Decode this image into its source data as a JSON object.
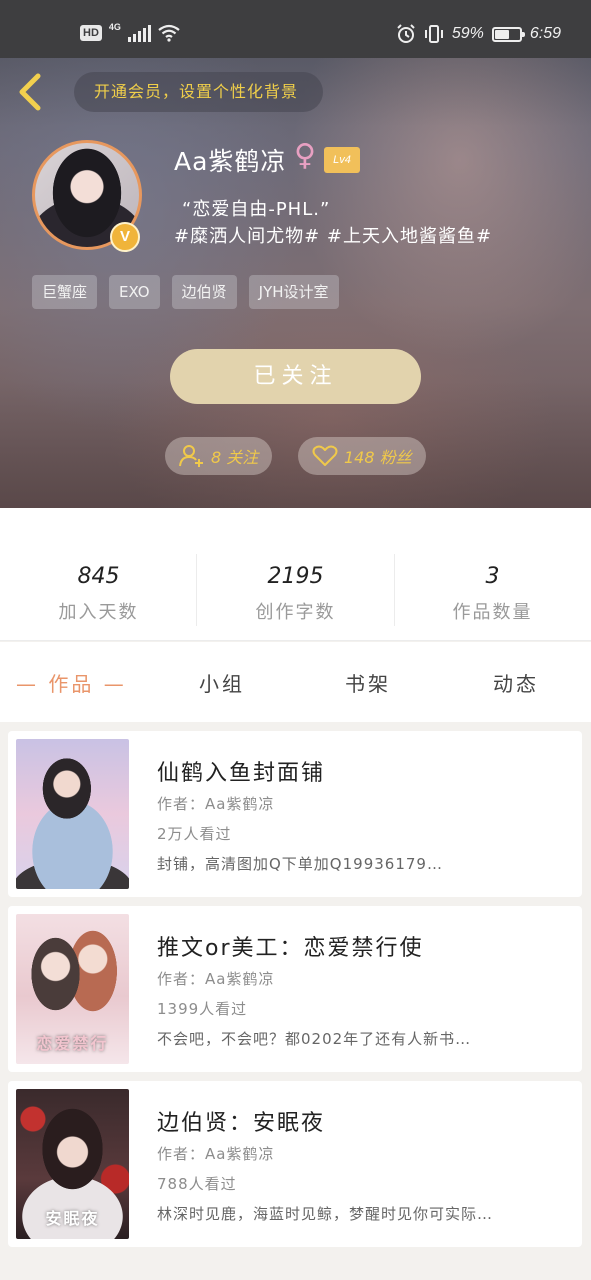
{
  "status_bar": {
    "hd": "HD",
    "network": "4G",
    "battery_percent": "59%",
    "battery_level": 0.59,
    "time": "6:59"
  },
  "header": {
    "vip_prompt": "开通会员，设置个性化背景"
  },
  "profile": {
    "username": "Aa紫鹤凉",
    "gender_symbol": "♀",
    "level": "Lv4",
    "avatar_badge": "V",
    "signature_line1": "“恋爱自由-PHL.”",
    "signature_line2": "#糜洒人间尤物# #上天入地酱酱鱼#",
    "tags": [
      "巨蟹座",
      "EXO",
      "边伯贤",
      "JYH设计室"
    ],
    "follow_label": "已关注",
    "following_text": "8 关注",
    "fans_text": "148 粉丝"
  },
  "stats": [
    {
      "value": "845",
      "label": "加入天数"
    },
    {
      "value": "2195",
      "label": "创作字数"
    },
    {
      "value": "3",
      "label": "作品数量"
    }
  ],
  "tabs": [
    {
      "label": "— 作品 —",
      "active": true
    },
    {
      "label": "小组",
      "active": false
    },
    {
      "label": "书架",
      "active": false
    },
    {
      "label": "动态",
      "active": false
    }
  ],
  "works": [
    {
      "title": "仙鹤入鱼封面铺",
      "author": "作者：Aa紫鹤凉",
      "views": "2万人看过",
      "desc": "封铺，高清图加Q下单加Q19936179…",
      "cover_text": ""
    },
    {
      "title": "推文or美工：恋爱禁行使",
      "author": "作者：Aa紫鹤凉",
      "views": "1399人看过",
      "desc": "不会吧，不会吧？都0202年了还有人新书…",
      "cover_text": "恋爱禁行"
    },
    {
      "title": "边伯贤：安眠夜",
      "author": "作者：Aa紫鹤凉",
      "views": "788人看过",
      "desc": "林深时见鹿，海蓝时见鲸，梦醒时见你可实际…",
      "cover_text": "安眠夜"
    }
  ],
  "colors": {
    "accent": "#e9956a",
    "gold": "#f0c94a",
    "follow_button": "#e2d3ad"
  }
}
